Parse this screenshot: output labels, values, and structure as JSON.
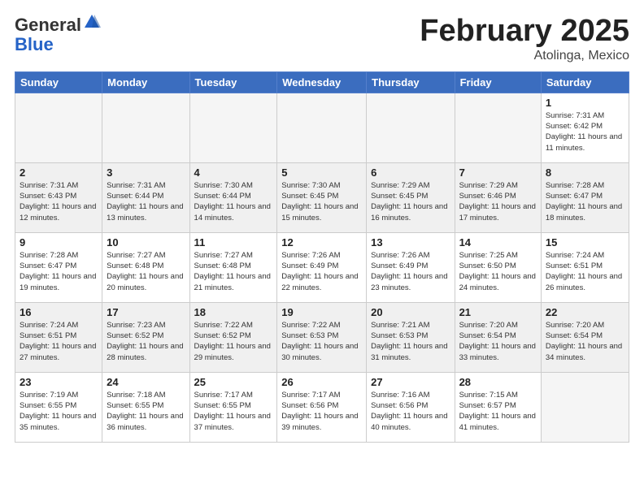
{
  "header": {
    "logo_general": "General",
    "logo_blue": "Blue",
    "month_title": "February 2025",
    "subtitle": "Atolinga, Mexico"
  },
  "weekdays": [
    "Sunday",
    "Monday",
    "Tuesday",
    "Wednesday",
    "Thursday",
    "Friday",
    "Saturday"
  ],
  "weeks": [
    [
      {
        "day": "",
        "info": ""
      },
      {
        "day": "",
        "info": ""
      },
      {
        "day": "",
        "info": ""
      },
      {
        "day": "",
        "info": ""
      },
      {
        "day": "",
        "info": ""
      },
      {
        "day": "",
        "info": ""
      },
      {
        "day": "1",
        "info": "Sunrise: 7:31 AM\nSunset: 6:42 PM\nDaylight: 11 hours\nand 11 minutes."
      }
    ],
    [
      {
        "day": "2",
        "info": "Sunrise: 7:31 AM\nSunset: 6:43 PM\nDaylight: 11 hours\nand 12 minutes."
      },
      {
        "day": "3",
        "info": "Sunrise: 7:31 AM\nSunset: 6:44 PM\nDaylight: 11 hours\nand 13 minutes."
      },
      {
        "day": "4",
        "info": "Sunrise: 7:30 AM\nSunset: 6:44 PM\nDaylight: 11 hours\nand 14 minutes."
      },
      {
        "day": "5",
        "info": "Sunrise: 7:30 AM\nSunset: 6:45 PM\nDaylight: 11 hours\nand 15 minutes."
      },
      {
        "day": "6",
        "info": "Sunrise: 7:29 AM\nSunset: 6:45 PM\nDaylight: 11 hours\nand 16 minutes."
      },
      {
        "day": "7",
        "info": "Sunrise: 7:29 AM\nSunset: 6:46 PM\nDaylight: 11 hours\nand 17 minutes."
      },
      {
        "day": "8",
        "info": "Sunrise: 7:28 AM\nSunset: 6:47 PM\nDaylight: 11 hours\nand 18 minutes."
      }
    ],
    [
      {
        "day": "9",
        "info": "Sunrise: 7:28 AM\nSunset: 6:47 PM\nDaylight: 11 hours\nand 19 minutes."
      },
      {
        "day": "10",
        "info": "Sunrise: 7:27 AM\nSunset: 6:48 PM\nDaylight: 11 hours\nand 20 minutes."
      },
      {
        "day": "11",
        "info": "Sunrise: 7:27 AM\nSunset: 6:48 PM\nDaylight: 11 hours\nand 21 minutes."
      },
      {
        "day": "12",
        "info": "Sunrise: 7:26 AM\nSunset: 6:49 PM\nDaylight: 11 hours\nand 22 minutes."
      },
      {
        "day": "13",
        "info": "Sunrise: 7:26 AM\nSunset: 6:49 PM\nDaylight: 11 hours\nand 23 minutes."
      },
      {
        "day": "14",
        "info": "Sunrise: 7:25 AM\nSunset: 6:50 PM\nDaylight: 11 hours\nand 24 minutes."
      },
      {
        "day": "15",
        "info": "Sunrise: 7:24 AM\nSunset: 6:51 PM\nDaylight: 11 hours\nand 26 minutes."
      }
    ],
    [
      {
        "day": "16",
        "info": "Sunrise: 7:24 AM\nSunset: 6:51 PM\nDaylight: 11 hours\nand 27 minutes."
      },
      {
        "day": "17",
        "info": "Sunrise: 7:23 AM\nSunset: 6:52 PM\nDaylight: 11 hours\nand 28 minutes."
      },
      {
        "day": "18",
        "info": "Sunrise: 7:22 AM\nSunset: 6:52 PM\nDaylight: 11 hours\nand 29 minutes."
      },
      {
        "day": "19",
        "info": "Sunrise: 7:22 AM\nSunset: 6:53 PM\nDaylight: 11 hours\nand 30 minutes."
      },
      {
        "day": "20",
        "info": "Sunrise: 7:21 AM\nSunset: 6:53 PM\nDaylight: 11 hours\nand 31 minutes."
      },
      {
        "day": "21",
        "info": "Sunrise: 7:20 AM\nSunset: 6:54 PM\nDaylight: 11 hours\nand 33 minutes."
      },
      {
        "day": "22",
        "info": "Sunrise: 7:20 AM\nSunset: 6:54 PM\nDaylight: 11 hours\nand 34 minutes."
      }
    ],
    [
      {
        "day": "23",
        "info": "Sunrise: 7:19 AM\nSunset: 6:55 PM\nDaylight: 11 hours\nand 35 minutes."
      },
      {
        "day": "24",
        "info": "Sunrise: 7:18 AM\nSunset: 6:55 PM\nDaylight: 11 hours\nand 36 minutes."
      },
      {
        "day": "25",
        "info": "Sunrise: 7:17 AM\nSunset: 6:55 PM\nDaylight: 11 hours\nand 37 minutes."
      },
      {
        "day": "26",
        "info": "Sunrise: 7:17 AM\nSunset: 6:56 PM\nDaylight: 11 hours\nand 39 minutes."
      },
      {
        "day": "27",
        "info": "Sunrise: 7:16 AM\nSunset: 6:56 PM\nDaylight: 11 hours\nand 40 minutes."
      },
      {
        "day": "28",
        "info": "Sunrise: 7:15 AM\nSunset: 6:57 PM\nDaylight: 11 hours\nand 41 minutes."
      },
      {
        "day": "",
        "info": ""
      }
    ]
  ]
}
